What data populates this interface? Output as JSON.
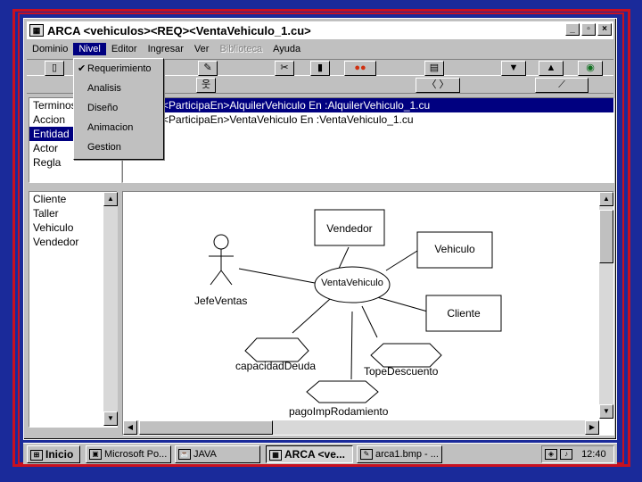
{
  "window": {
    "title": "ARCA <vehiculos><REQ><VentaVehiculo_1.cu>"
  },
  "menubar": [
    "Dominio",
    "Nivel",
    "Editor",
    "Ingresar",
    "Ver",
    "Biblioteca",
    "Ayuda"
  ],
  "nivel_menu": [
    "Requerimiento",
    "Analisis",
    "Diseño",
    "Animacion",
    "Gestion"
  ],
  "element_types": [
    "Terminos",
    "Accion",
    "Entidad",
    "Actor",
    "Regla"
  ],
  "relations": [
    "<ParticipaEn>AlquilerVehiculo En :AlquilerVehiculo_1.cu",
    "<ParticipaEn>VentaVehiculo En :VentaVehiculo_1.cu"
  ],
  "entities": [
    "Cliente",
    "Taller",
    "Vehiculo",
    "Vendedor"
  ],
  "diagram": {
    "actor": "JefeVentas",
    "usecase": "VentaVehiculo",
    "boxes": [
      "Vendedor",
      "Vehiculo",
      "Cliente"
    ],
    "hexagons": [
      "capacidadDeuda",
      "TopeDescuento",
      "pagoImpRodamiento"
    ]
  },
  "taskbar": {
    "start": "Inicio",
    "tasks": [
      "Microsoft Po...",
      "JAVA",
      "ARCA <ve...",
      "arca1.bmp - ..."
    ],
    "clock": "12:40"
  }
}
